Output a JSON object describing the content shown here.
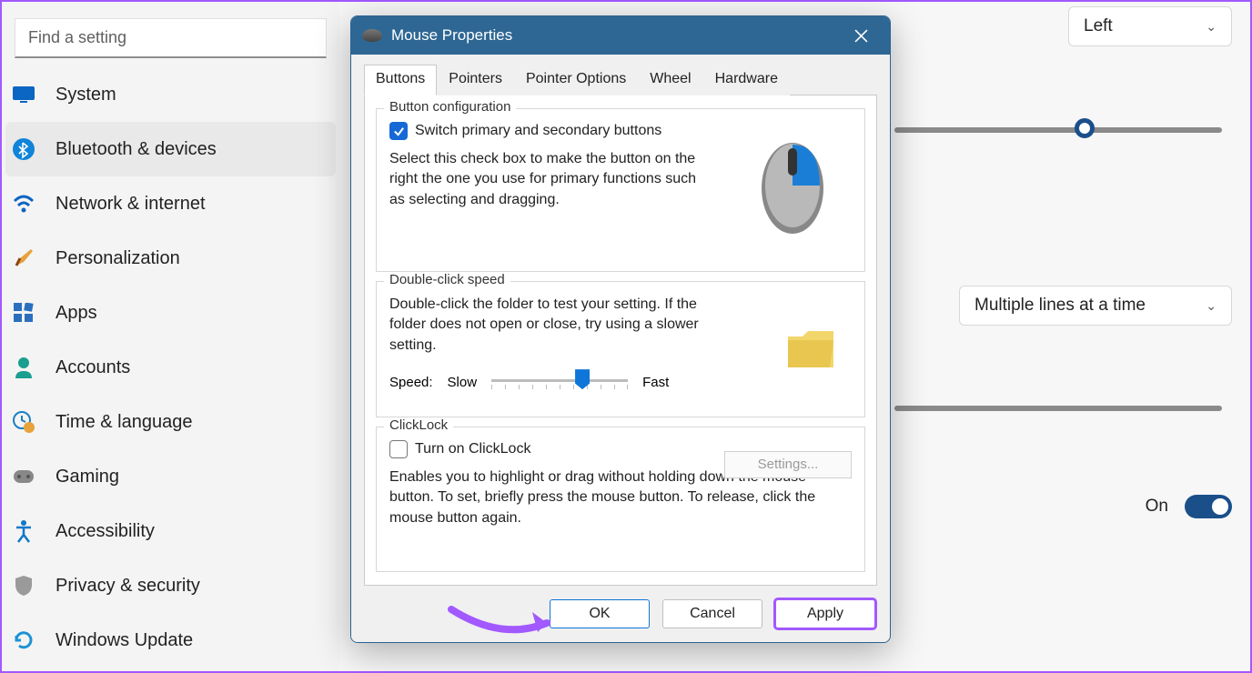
{
  "search": {
    "placeholder": "Find a setting"
  },
  "sidebar": {
    "items": [
      {
        "label": "System"
      },
      {
        "label": "Bluetooth & devices"
      },
      {
        "label": "Network & internet"
      },
      {
        "label": "Personalization"
      },
      {
        "label": "Apps"
      },
      {
        "label": "Accounts"
      },
      {
        "label": "Time & language"
      },
      {
        "label": "Gaming"
      },
      {
        "label": "Accessibility"
      },
      {
        "label": "Privacy & security"
      },
      {
        "label": "Windows Update"
      }
    ],
    "selected_index": 1
  },
  "bg": {
    "primary_button_dropdown": "Left",
    "scroll_dropdown": "Multiple lines at a time",
    "toggle_label": "On"
  },
  "dialog": {
    "title": "Mouse Properties",
    "tabs": [
      "Buttons",
      "Pointers",
      "Pointer Options",
      "Wheel",
      "Hardware"
    ],
    "active_tab": 0,
    "button_config": {
      "group_title": "Button configuration",
      "checkbox_label": "Switch primary and secondary buttons",
      "checkbox_checked": true,
      "desc": "Select this check box to make the button on the right the one you use for primary functions such as selecting and dragging."
    },
    "double_click": {
      "group_title": "Double-click speed",
      "desc": "Double-click the folder to test your setting. If the folder does not open or close, try using a slower setting.",
      "speed_label": "Speed:",
      "slow_label": "Slow",
      "fast_label": "Fast",
      "value_percent": 65
    },
    "clicklock": {
      "group_title": "ClickLock",
      "checkbox_label": "Turn on ClickLock",
      "checkbox_checked": false,
      "settings_btn": "Settings...",
      "desc": "Enables you to highlight or drag without holding down the mouse button. To set, briefly press the mouse button. To release, click the mouse button again."
    },
    "footer": {
      "ok": "OK",
      "cancel": "Cancel",
      "apply": "Apply"
    }
  }
}
